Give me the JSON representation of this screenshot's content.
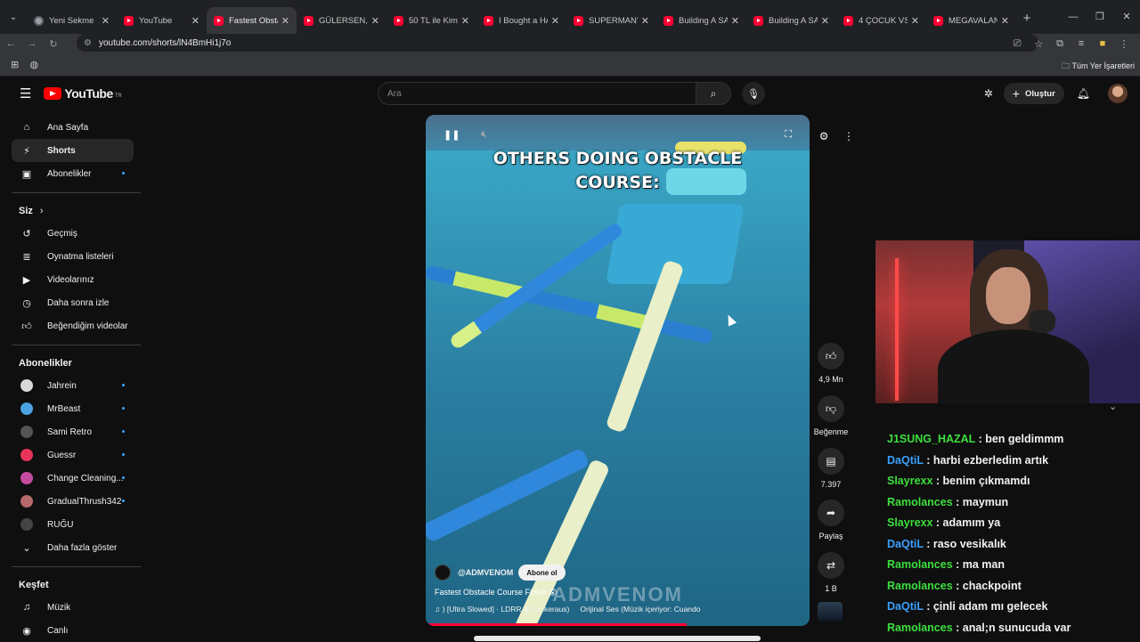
{
  "browser": {
    "tabs": [
      {
        "label": "Yeni Sekme",
        "icon": "chrome-icon",
        "active": false
      },
      {
        "label": "YouTube",
        "icon": "youtube-icon",
        "active": false
      },
      {
        "label": "Fastest Obstacl",
        "icon": "youtube-icon",
        "active": true
      },
      {
        "label": "GÜLERSEN, KA",
        "icon": "youtube-icon",
        "active": false
      },
      {
        "label": "50 TL ile Kim E",
        "icon": "youtube-icon",
        "active": false
      },
      {
        "label": "I Bought a HA",
        "icon": "youtube-icon",
        "active": false
      },
      {
        "label": "SUPERMAN'IN",
        "icon": "youtube-icon",
        "active": false
      },
      {
        "label": "Building A SA",
        "icon": "youtube-icon",
        "active": false
      },
      {
        "label": "Building A SA",
        "icon": "youtube-icon",
        "active": false
      },
      {
        "label": "4 ÇOCUK VS T",
        "icon": "youtube-icon",
        "active": false
      },
      {
        "label": "MEGAVALANC",
        "icon": "youtube-icon",
        "active": false
      }
    ],
    "url": "youtube.com/shorts/lN4BmHi1j7o",
    "bookmarks_all": "Tüm Yer İşaretleri"
  },
  "youtube": {
    "logo_text": "YouTube",
    "country": "TR",
    "search_placeholder": "Ara",
    "create_label": "Oluştur",
    "nav": [
      {
        "label": "Ana Sayfa",
        "icon": "home-icon",
        "active": false
      },
      {
        "label": "Shorts",
        "icon": "shorts-icon",
        "active": true
      },
      {
        "label": "Abonelikler",
        "icon": "subscriptions-icon",
        "active": false
      }
    ],
    "you_heading": "Siz",
    "you_items": [
      {
        "label": "Geçmiş",
        "icon": "history-icon"
      },
      {
        "label": "Oynatma listeleri",
        "icon": "playlists-icon"
      },
      {
        "label": "Videolarınız",
        "icon": "your-videos-icon"
      },
      {
        "label": "Daha sonra izle",
        "icon": "watch-later-icon"
      },
      {
        "label": "Beğendiğim videolar",
        "icon": "liked-icon"
      }
    ],
    "subs_heading": "Abonelikler",
    "subscriptions": [
      {
        "label": "Jahrein",
        "color": "#d8d8d8"
      },
      {
        "label": "MrBeast",
        "color": "#4aa3df"
      },
      {
        "label": "Sami Retro",
        "color": "#555555"
      },
      {
        "label": "Guessr",
        "color": "#e8345a"
      },
      {
        "label": "Change Cleaning...",
        "color": "#c64aa0"
      },
      {
        "label": "GradualThrush342",
        "color": "#b56a6a"
      },
      {
        "label": "RUĞU",
        "color": "#444444"
      }
    ],
    "show_more": "Daha fazla göster",
    "explore_heading": "Keşfet",
    "explore": [
      {
        "label": "Müzik",
        "icon": "music-icon"
      },
      {
        "label": "Canlı",
        "icon": "live-icon"
      }
    ]
  },
  "short": {
    "overlay_text_line1": "OTHERS DOING OBSTACLE",
    "overlay_text_line2": "COURSE:",
    "channel": "@ADMVENOM",
    "subscribe": "Abone ol",
    "title": "Fastest Obstacle Course Finish 😲",
    "sound": "♫ ) [Ultra Slowed] · LDRR & DJ Ikeraus)",
    "original_sound": "Orijinal Ses (Müzik içeriyor: Cuando",
    "watermark": "ADMVENOM",
    "progress": 0.68,
    "likes": "4,9 Mn",
    "dislike_label": "Beğenme",
    "comments": "7.397",
    "share_label": "Paylaş",
    "remix_count": "1 B"
  },
  "chat": [
    {
      "user": "J1SUNG_HAZAL",
      "text": "ben geldimmm",
      "color": "green"
    },
    {
      "user": "DaQtiL",
      "text": "harbi ezberledim artık",
      "color": "blue"
    },
    {
      "user": "Slayrexx",
      "text": "benim çıkmamdı",
      "color": "green"
    },
    {
      "user": "Ramolances",
      "text": "maymun",
      "color": "green"
    },
    {
      "user": "Slayrexx",
      "text": "adamım ya",
      "color": "green"
    },
    {
      "user": "DaQtiL",
      "text": "raso vesikalık",
      "color": "blue"
    },
    {
      "user": "Ramolances",
      "text": "ma man",
      "color": "green"
    },
    {
      "user": "Ramolances",
      "text": "chackpoint",
      "color": "green"
    },
    {
      "user": "DaQtiL",
      "text": "çinli adam mı gelecek",
      "color": "blue"
    },
    {
      "user": "Ramolances",
      "text": "anal;n sunucuda var",
      "color": "green"
    }
  ]
}
